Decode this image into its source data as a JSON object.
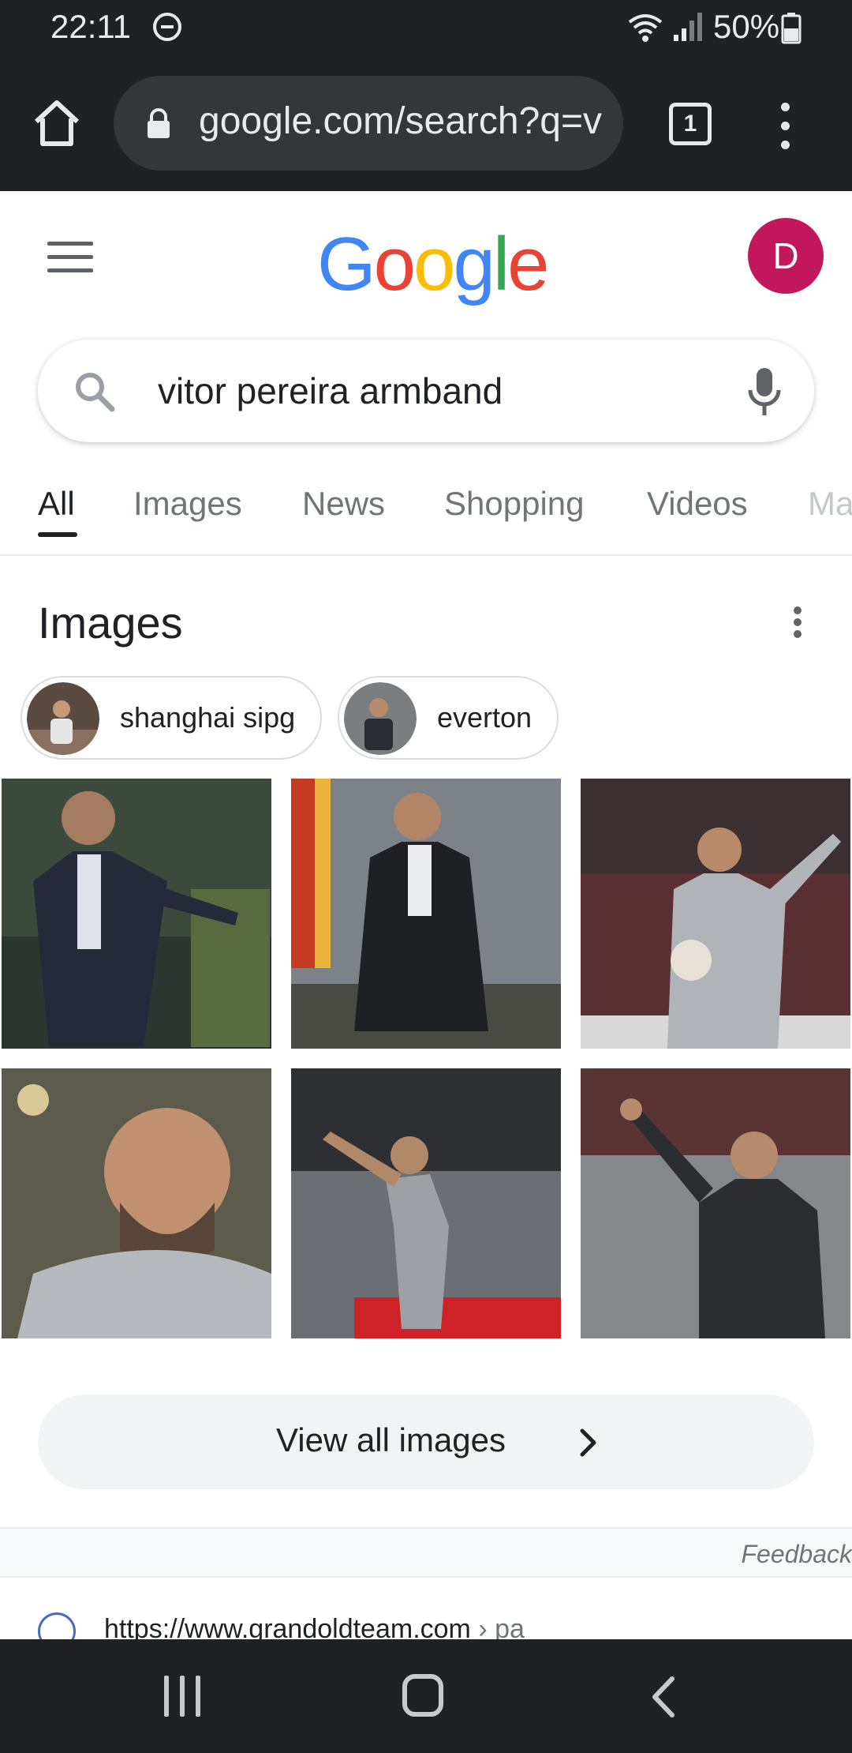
{
  "status_bar": {
    "time": "22:11",
    "battery": "50%"
  },
  "browser": {
    "url": "google.com/search?q=v",
    "tab_count": "1"
  },
  "header": {
    "logo": "Google",
    "avatar_initial": "D"
  },
  "search": {
    "query": "vitor pereira armband"
  },
  "tabs": [
    {
      "label": "All",
      "active": true
    },
    {
      "label": "Images"
    },
    {
      "label": "News"
    },
    {
      "label": "Shopping"
    },
    {
      "label": "Videos"
    },
    {
      "label": "Ma"
    }
  ],
  "images_section": {
    "title": "Images",
    "chips": [
      {
        "label": "shanghai sipg"
      },
      {
        "label": "everton"
      }
    ],
    "view_all_label": "View all images"
  },
  "feedback_label": "Feedback",
  "result": {
    "url": "https://www.grandoldteam.com",
    "crumb": " › pa"
  },
  "colors": {
    "toolbar_bg": "#202124",
    "avatar_bg": "#c2185b",
    "google_blue": "#4285F4",
    "google_red": "#EA4335",
    "google_yellow": "#FBBC05",
    "google_green": "#34A853"
  }
}
